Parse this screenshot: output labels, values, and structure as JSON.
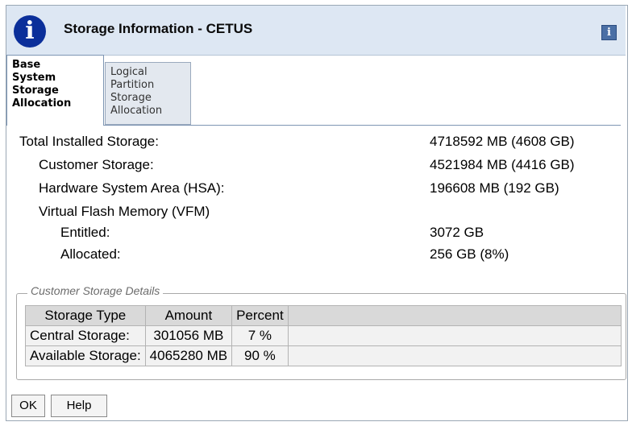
{
  "window": {
    "title": "Storage Information - CETUS",
    "info_icon_glyph": "i",
    "help_icon_glyph": "i"
  },
  "tabs": [
    {
      "label_lines": [
        "Base",
        "System",
        "Storage",
        "Allocation"
      ],
      "active": true
    },
    {
      "label_lines": [
        "Logical",
        "Partition",
        "Storage",
        "Allocation"
      ],
      "active": false
    }
  ],
  "storage": {
    "total_label": "Total Installed Storage:",
    "total_value": "4718592 MB (4608 GB)",
    "customer_label": "Customer Storage:",
    "customer_value": "4521984 MB (4416 GB)",
    "hsa_label": "Hardware System Area (HSA):",
    "hsa_value": "196608 MB (192 GB)",
    "vfm_label": "Virtual Flash Memory (VFM)",
    "entitled_label": "Entitled:",
    "entitled_value": "3072 GB",
    "allocated_label": "Allocated:",
    "allocated_value": "256 GB (8%)"
  },
  "details": {
    "legend": "Customer Storage Details",
    "columns": [
      "Storage Type",
      "Amount",
      "Percent"
    ],
    "rows": [
      [
        "Central Storage:",
        "301056 MB",
        "7 %"
      ],
      [
        "Available Storage:",
        "4065280 MB",
        "90 %"
      ]
    ]
  },
  "buttons": {
    "ok_label": "OK",
    "help_label": "Help"
  },
  "colors": {
    "title_bar": "#dde7f3",
    "info_icon": "#0b2f9a",
    "table_header": "#d9d9d9"
  }
}
